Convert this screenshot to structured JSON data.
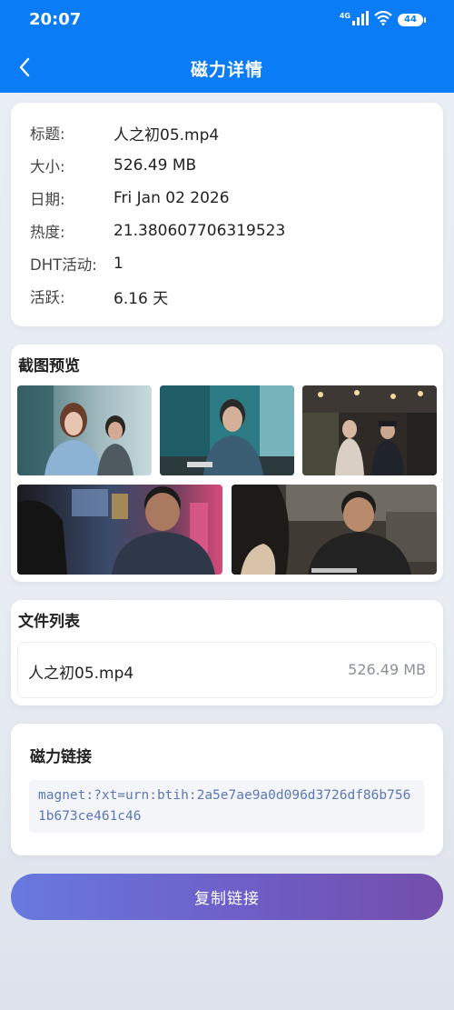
{
  "status_bar": {
    "time": "20:07",
    "network": "4G",
    "battery": "44",
    "icons": [
      "signal-icon",
      "wifi-icon",
      "battery-icon"
    ]
  },
  "nav": {
    "title": "磁力详情",
    "back_icon": "chevron-left-icon"
  },
  "info": {
    "title_label": "标题:",
    "title_value": "人之初05.mp4",
    "size_label": "大小:",
    "size_value": "526.49 MB",
    "date_label": "日期:",
    "date_value": "Fri Jan 02 2026",
    "heat_label": "热度:",
    "heat_value": "21.380607706319523",
    "dht_label": "DHT活动:",
    "dht_value": "1",
    "active_label": "活跃:",
    "active_value": "6.16 天"
  },
  "screenshots": {
    "title": "截图预览",
    "count": 5
  },
  "files": {
    "title": "文件列表",
    "items": [
      {
        "name": "人之初05.mp4",
        "size": "526.49 MB"
      }
    ]
  },
  "magnet": {
    "title": "磁力链接",
    "link": "magnet:?xt=urn:btih:2a5e7ae9a0d096d3726df86b7561b673ce461c46"
  },
  "copy_button": {
    "label": "复制链接"
  },
  "colors": {
    "header": "#0a7cf5",
    "button_start": "#6879df",
    "button_end": "#744eaa",
    "magnet_text": "#5b78b8"
  }
}
